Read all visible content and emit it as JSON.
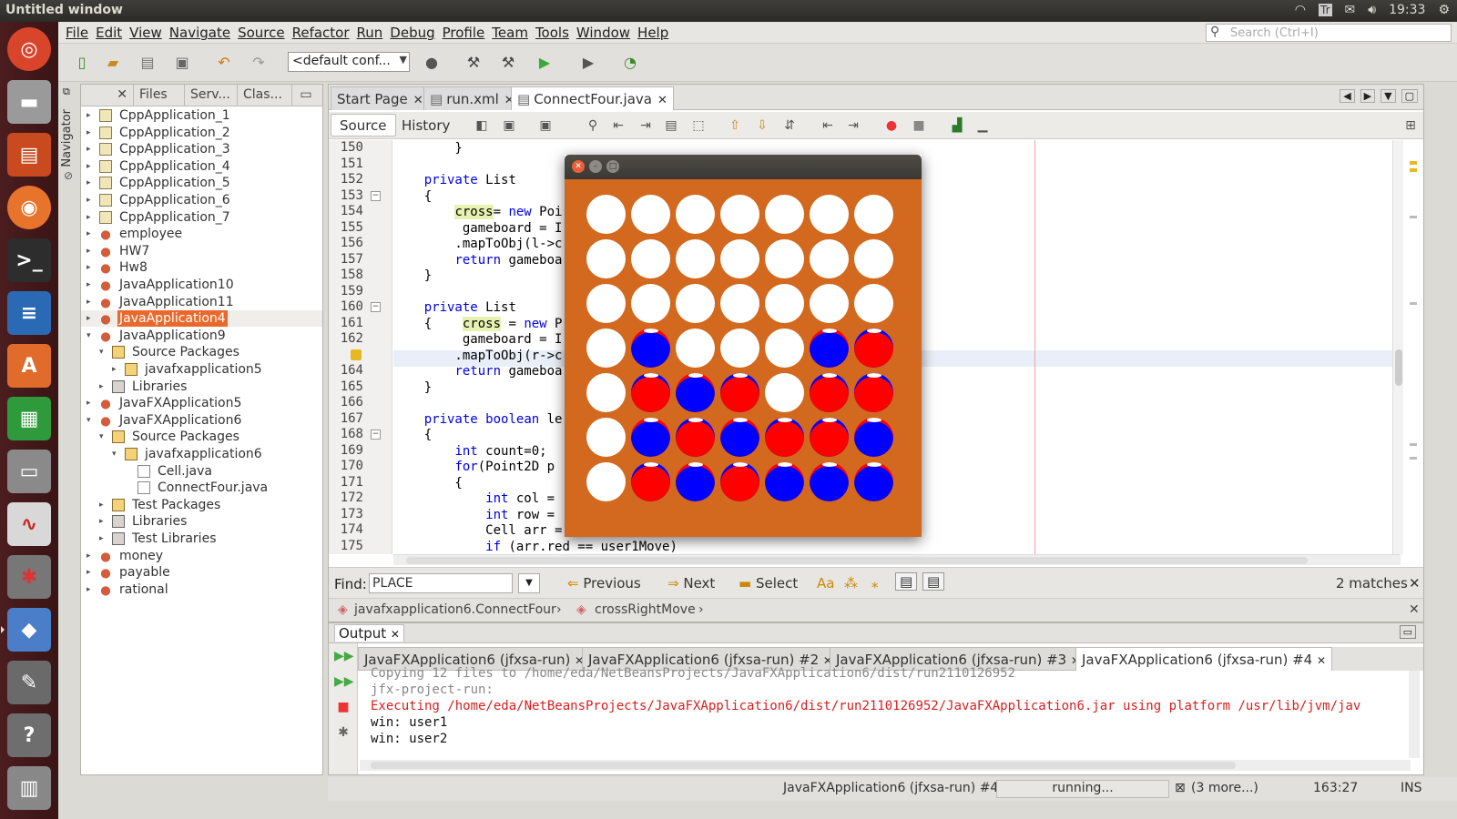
{
  "window": {
    "title": "Untitled window"
  },
  "tray": {
    "lang": "Tr",
    "time": "19:33"
  },
  "menubar": {
    "items": [
      "File",
      "Edit",
      "View",
      "Navigate",
      "Source",
      "Refactor",
      "Run",
      "Debug",
      "Profile",
      "Team",
      "Tools",
      "Window",
      "Help"
    ]
  },
  "search": {
    "placeholder": "Search (Ctrl+I)"
  },
  "toolbar": {
    "config": "<default conf..."
  },
  "navigator": {
    "label": "Navigator"
  },
  "left_tabs": [
    "Files",
    "Serv...",
    "Clas..."
  ],
  "projects": [
    {
      "label": "CppApplication_1",
      "icon": "cpp-project-icon",
      "level": 0,
      "toggle": "▸"
    },
    {
      "label": "CppApplication_2",
      "icon": "cpp-project-icon",
      "level": 0,
      "toggle": "▸"
    },
    {
      "label": "CppApplication_3",
      "icon": "cpp-project-icon",
      "level": 0,
      "toggle": "▸"
    },
    {
      "label": "CppApplication_4",
      "icon": "cpp-project-icon",
      "level": 0,
      "toggle": "▸"
    },
    {
      "label": "CppApplication_5",
      "icon": "cpp-project-icon",
      "level": 0,
      "toggle": "▸"
    },
    {
      "label": "CppApplication_6",
      "icon": "cpp-project-icon",
      "level": 0,
      "toggle": "▸"
    },
    {
      "label": "CppApplication_7",
      "icon": "cpp-project-icon",
      "level": 0,
      "toggle": "▸"
    },
    {
      "label": "employee",
      "icon": "java-project-icon",
      "level": 0,
      "toggle": "▸"
    },
    {
      "label": "HW7",
      "icon": "java-project-icon",
      "level": 0,
      "toggle": "▸"
    },
    {
      "label": "Hw8",
      "icon": "java-project-icon",
      "level": 0,
      "toggle": "▸"
    },
    {
      "label": "JavaApplication10",
      "icon": "java-project-icon",
      "level": 0,
      "toggle": "▸"
    },
    {
      "label": "JavaApplication11",
      "icon": "java-project-icon",
      "level": 0,
      "toggle": "▸"
    },
    {
      "label": "JavaApplication4",
      "icon": "java-project-icon",
      "level": 0,
      "toggle": "▸",
      "selected": true
    },
    {
      "label": "JavaApplication9",
      "icon": "java-project-icon",
      "level": 0,
      "toggle": "▾"
    },
    {
      "label": "Source Packages",
      "icon": "source-packages-icon",
      "level": 1,
      "toggle": "▾"
    },
    {
      "label": "javafxapplication5",
      "icon": "package-icon",
      "level": 2,
      "toggle": "▸"
    },
    {
      "label": "Libraries",
      "icon": "libraries-icon",
      "level": 1,
      "toggle": "▸"
    },
    {
      "label": "JavaFXApplication5",
      "icon": "javafx-project-icon",
      "level": 0,
      "toggle": "▸"
    },
    {
      "label": "JavaFXApplication6",
      "icon": "javafx-project-icon",
      "level": 0,
      "toggle": "▾"
    },
    {
      "label": "Source Packages",
      "icon": "source-packages-icon",
      "level": 1,
      "toggle": "▾"
    },
    {
      "label": "javafxapplication6",
      "icon": "package-icon",
      "level": 2,
      "toggle": "▾"
    },
    {
      "label": "Cell.java",
      "icon": "java-file-icon",
      "level": 3,
      "toggle": ""
    },
    {
      "label": "ConnectFour.java",
      "icon": "java-file-icon",
      "level": 3,
      "toggle": ""
    },
    {
      "label": "Test Packages",
      "icon": "source-packages-icon",
      "level": 1,
      "toggle": "▸"
    },
    {
      "label": "Libraries",
      "icon": "libraries-icon",
      "level": 1,
      "toggle": "▸"
    },
    {
      "label": "Test Libraries",
      "icon": "libraries-icon",
      "level": 1,
      "toggle": "▸"
    },
    {
      "label": "money",
      "icon": "java-project-icon",
      "level": 0,
      "toggle": "▸"
    },
    {
      "label": "payable",
      "icon": "java-project-icon",
      "level": 0,
      "toggle": "▸"
    },
    {
      "label": "rational",
      "icon": "java-project-icon",
      "level": 0,
      "toggle": "▸"
    }
  ],
  "editor_tabs": [
    {
      "label": "Start Page",
      "active": false
    },
    {
      "label": "run.xml",
      "active": false
    },
    {
      "label": "ConnectFour.java",
      "active": true
    }
  ],
  "editor_toolbar": {
    "source": "Source",
    "history": "History"
  },
  "code_lines": [
    {
      "n": "150",
      "t": "        }"
    },
    {
      "n": "151",
      "t": ""
    },
    {
      "n": "152",
      "t": "    private List<Point"
    },
    {
      "n": "153",
      "t": "    {"
    },
    {
      "n": "154",
      "t": "        cross= new Poi"
    },
    {
      "n": "155",
      "t": "         gameboard = I"
    },
    {
      "n": "156",
      "t": "        .mapToObj(l->c"
    },
    {
      "n": "157",
      "t": "        return gameboa"
    },
    {
      "n": "158",
      "t": "    }"
    },
    {
      "n": "159",
      "t": ""
    },
    {
      "n": "160",
      "t": "    private List<Point"
    },
    {
      "n": "161",
      "t": "    {    cross = new P"
    },
    {
      "n": "162",
      "t": "         gameboard = I"
    },
    {
      "n": "",
      "t": "        .mapToObj(r->c"
    },
    {
      "n": "164",
      "t": "        return gameboa"
    },
    {
      "n": "165",
      "t": "    }"
    },
    {
      "n": "166",
      "t": ""
    },
    {
      "n": "167",
      "t": "    private boolean le"
    },
    {
      "n": "168",
      "t": "    {"
    },
    {
      "n": "169",
      "t": "        int count=0;"
    },
    {
      "n": "170",
      "t": "        for(Point2D p"
    },
    {
      "n": "171",
      "t": "        {"
    },
    {
      "n": "172",
      "t": "            int col ="
    },
    {
      "n": "173",
      "t": "            int row ="
    },
    {
      "n": "174",
      "t": "            Cell arr = getBall(col, row).orElse(new Cell(user1Move));"
    },
    {
      "n": "175",
      "t": "            if (arr.red == user1Move)"
    }
  ],
  "find": {
    "label": "Find:",
    "value": "PLACE",
    "previous": "Previous",
    "next": "Next",
    "select": "Select",
    "matches": "2 matches"
  },
  "breadcrumb": {
    "class": "javafxapplication6.ConnectFour",
    "method": "crossRightMove"
  },
  "output": {
    "title": "Output",
    "tabs": [
      "JavaFXApplication6 (jfxsa-run)",
      "JavaFXApplication6 (jfxsa-run) #2",
      "JavaFXApplication6 (jfxsa-run) #3",
      "JavaFXApplication6 (jfxsa-run) #4"
    ],
    "lines": [
      {
        "text": "Copying 12 files to /home/eda/NetBeansProjects/JavaFXApplication6/dist/run2110126952",
        "style": "gray"
      },
      {
        "text": "jfx-project-run:",
        "style": "gray"
      },
      {
        "text": "Executing /home/eda/NetBeansProjects/JavaFXApplication6/dist/run2110126952/JavaFXApplication6.jar using platform /usr/lib/jvm/jav",
        "style": "red"
      },
      {
        "text": "win: user1",
        "style": "normal"
      },
      {
        "text": "win: user2",
        "style": "normal"
      }
    ]
  },
  "status": {
    "task": "JavaFXApplication6 (jfxsa-run) #4",
    "progress": "running...",
    "more": "(3 more...)",
    "position": "163:27",
    "mode": "INS"
  },
  "game": {
    "board": [
      [
        "empty",
        "empty",
        "empty",
        "empty",
        "empty",
        "empty",
        "empty"
      ],
      [
        "empty",
        "empty",
        "empty",
        "empty",
        "empty",
        "empty",
        "empty"
      ],
      [
        "empty",
        "empty",
        "empty",
        "empty",
        "empty",
        "empty",
        "empty"
      ],
      [
        "empty",
        "blue",
        "empty",
        "empty",
        "empty",
        "blue",
        "red"
      ],
      [
        "empty",
        "red",
        "blue",
        "red",
        "empty",
        "red",
        "red"
      ],
      [
        "empty",
        "blue",
        "red",
        "blue",
        "red",
        "red",
        "blue"
      ],
      [
        "empty",
        "red",
        "blue",
        "red",
        "blue",
        "blue",
        "blue"
      ]
    ],
    "colors": {
      "background": "#d2691e",
      "red": "#ff0000",
      "blue": "#0000ff",
      "empty": "#ffffff"
    }
  }
}
